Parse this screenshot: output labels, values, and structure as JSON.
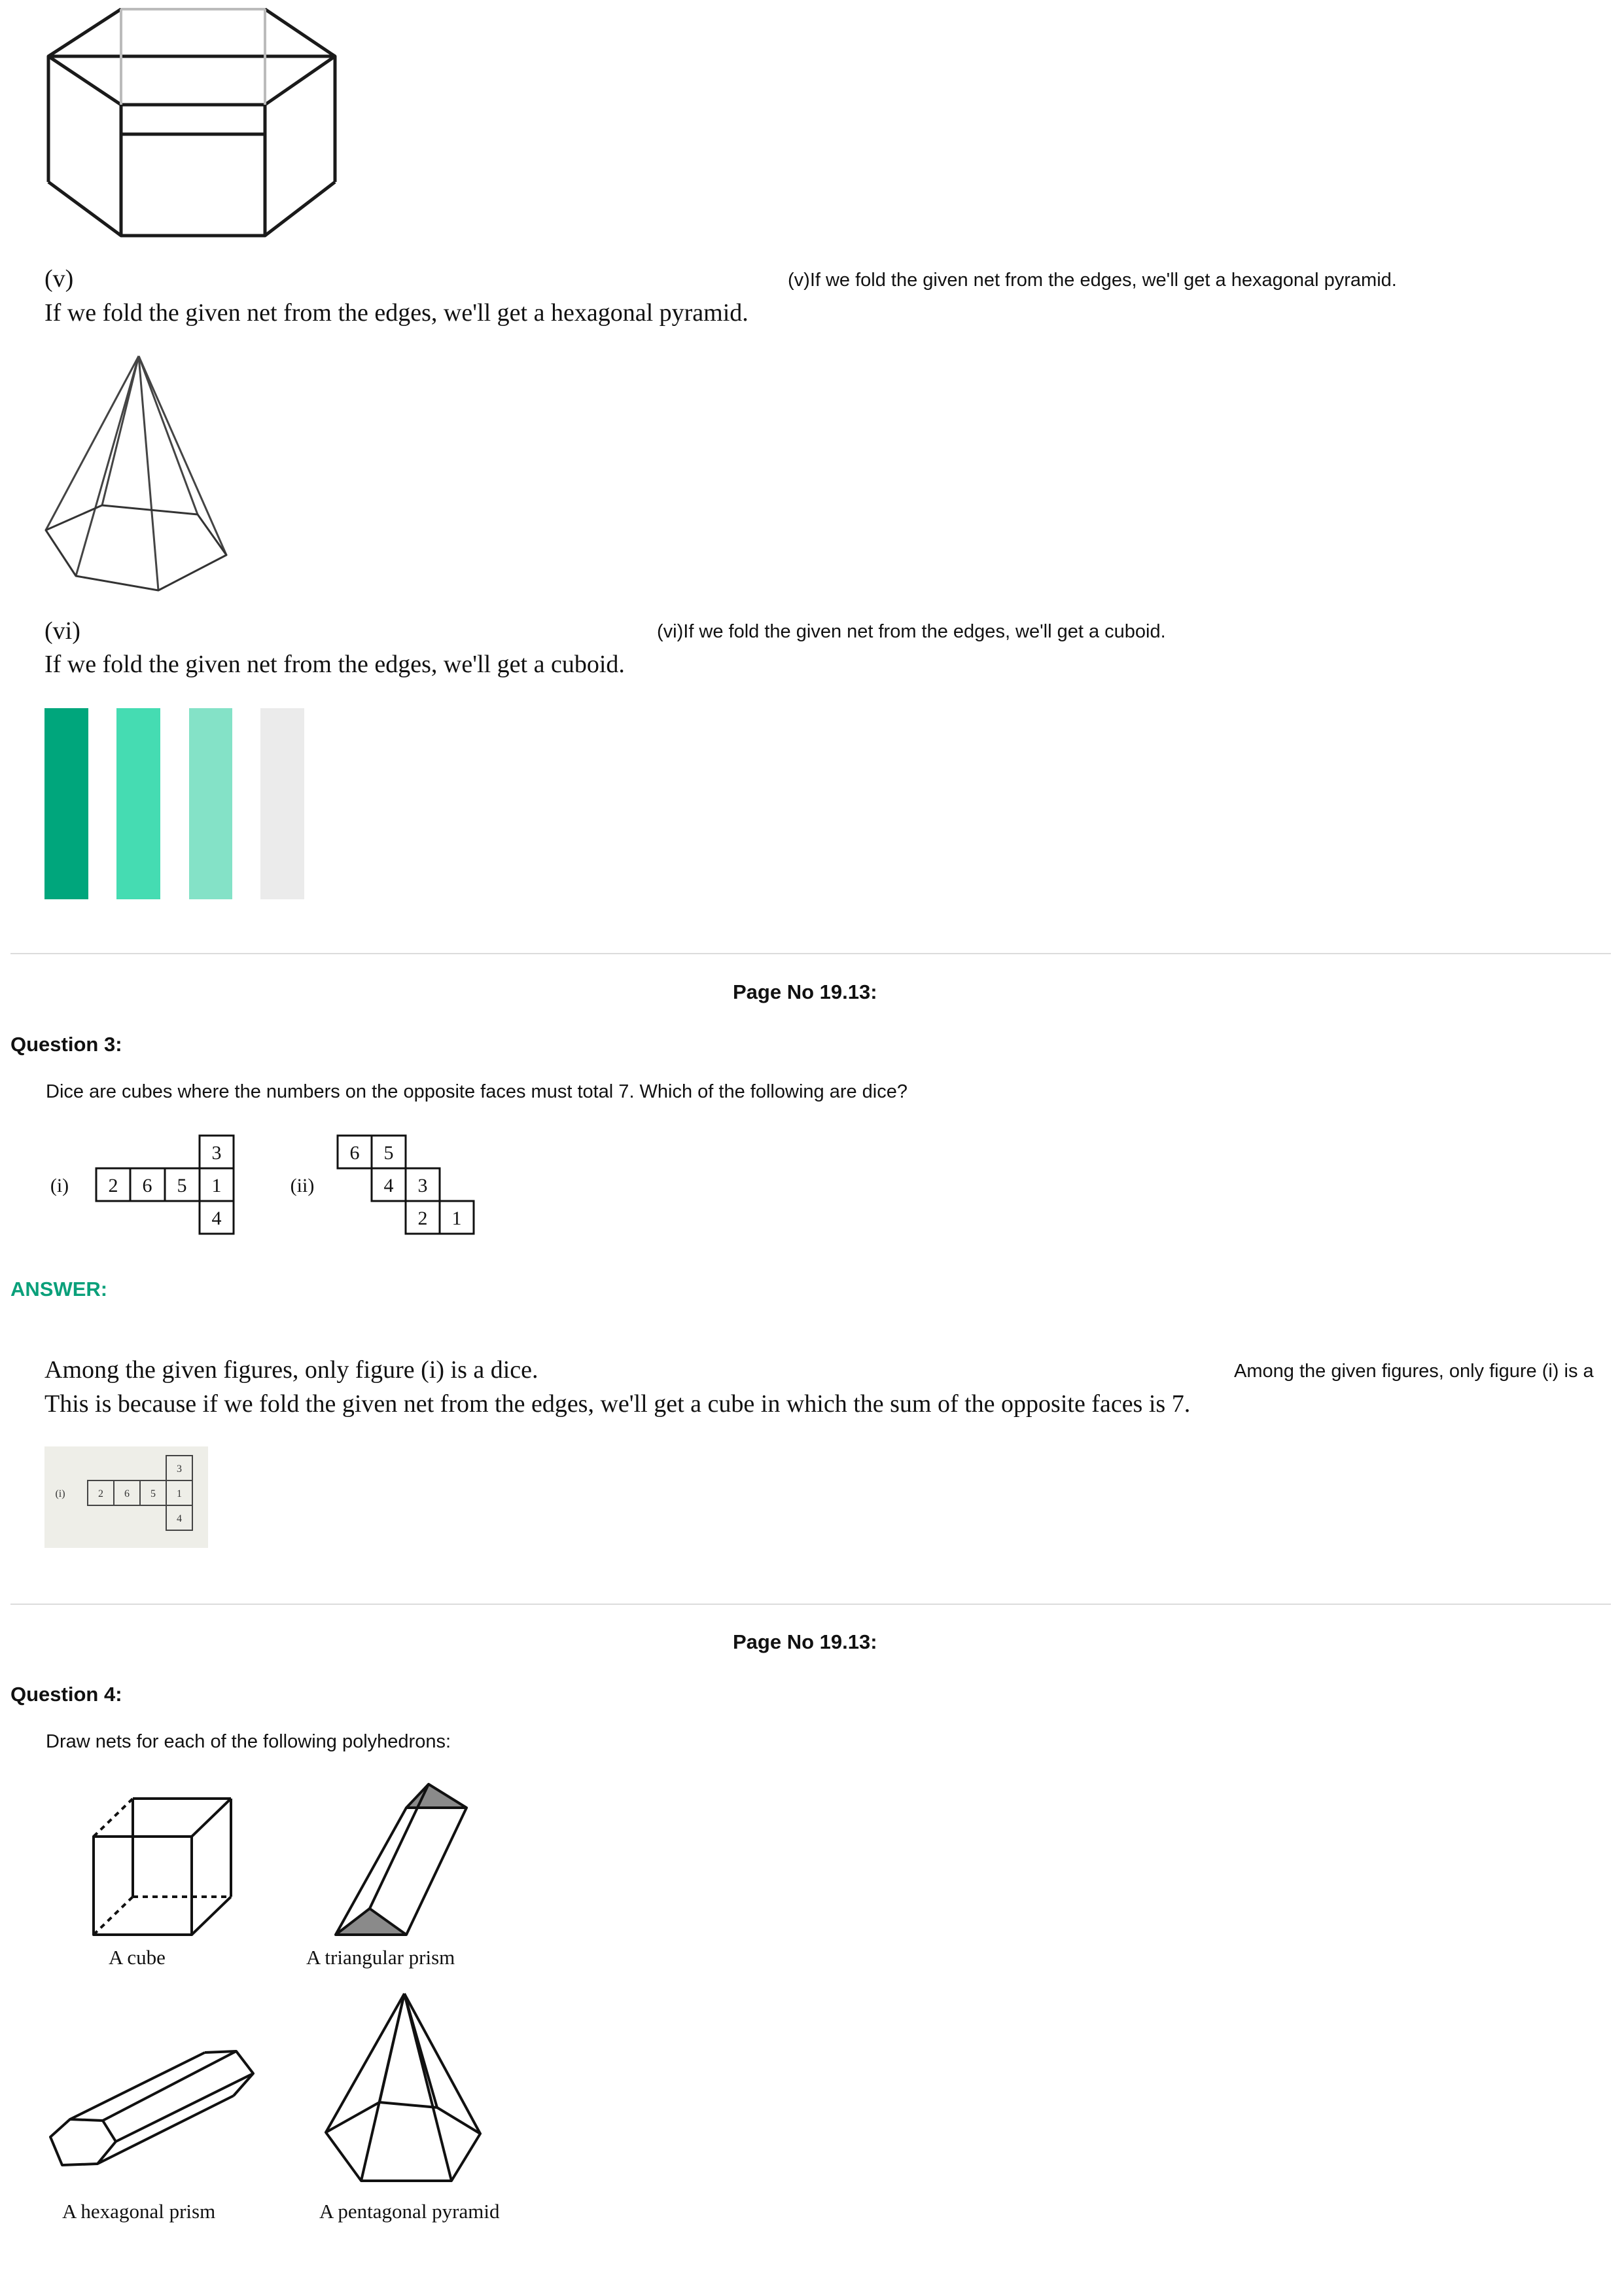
{
  "part_v": {
    "label": "(v)",
    "text": "If we fold the given  net  from the edges, we'll get a hexagonal pyramid.",
    "alt_text": "(v)If we fold the given net from the edges, we'll get a hexagonal pyramid."
  },
  "part_vi": {
    "label": "(vi)",
    "text": "If we fold the given  net  from the edges, we'll get a cuboid.",
    "alt_text": "(vi)If we fold the given net from the edges, we'll get a cuboid."
  },
  "color_bars": [
    "#00a67c",
    "#45dcb2",
    "#84e2c7",
    "#ebebeb"
  ],
  "q3": {
    "page": "Page No 19.13:",
    "title": "Question 3:",
    "prompt": "Dice are cubes where the numbers on the opposite faces must total 7. Which of the following are dice?",
    "fig_i": {
      "label": "(i)",
      "top": "3",
      "row": [
        "2",
        "6",
        "5",
        "1"
      ],
      "bottom": "4"
    },
    "fig_ii": {
      "label": "(ii)",
      "row1": [
        "6",
        "5"
      ],
      "row2": [
        "4",
        "3"
      ],
      "row3": [
        "2",
        "1"
      ]
    },
    "answer_label": "ANSWER:",
    "answer_line1": "Among the given figures, only figure (i) is a dice.",
    "answer_line2": "This is because if we fold the given net from the edges, we'll get a cube in which the sum of the opposite faces is 7.",
    "answer_alt": "Among the given figures, only figure (i) is a"
  },
  "q4": {
    "page": "Page No 19.13:",
    "title": "Question 4:",
    "prompt": "Draw nets for each of the following polyhedrons:",
    "captions": {
      "cube": "A cube",
      "triangular_prism": "A triangular prism",
      "hexagonal_prism": "A hexagonal prism",
      "pentagonal_pyramid": "A pentagonal pyramid"
    }
  }
}
